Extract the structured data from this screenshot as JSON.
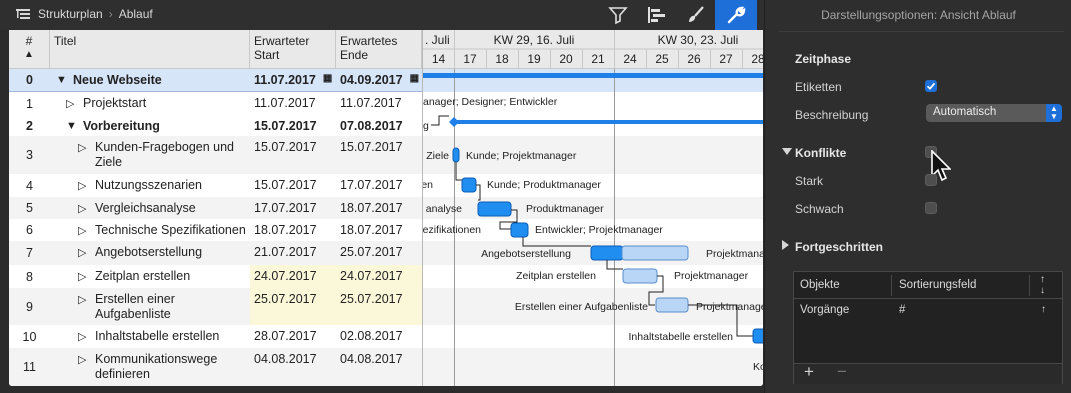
{
  "breadcrumb": {
    "item1": "Strukturplan",
    "item2": "Ablauf"
  },
  "toolbar": {
    "active_color": "#1f6fd8"
  },
  "table": {
    "headers": {
      "num": "#",
      "title": "Titel",
      "start_l1": "Erwarteter",
      "start_l2": "Start",
      "end_l1": "Erwartetes",
      "end_l2": "Ende"
    },
    "rows": [
      {
        "num": "0",
        "title": "Neue Webseite",
        "start": "11.07.2017",
        "end": "04.09.2017"
      },
      {
        "num": "1",
        "title": "Projektstart",
        "start": "11.07.2017",
        "end": "11.07.2017"
      },
      {
        "num": "2",
        "title": "Vorbereitung",
        "start": "15.07.2017",
        "end": "07.08.2017"
      },
      {
        "num": "3",
        "title": "Kunden-Fragebogen und",
        "title2": "Ziele",
        "start": "15.07.2017",
        "end": "15.07.2017"
      },
      {
        "num": "4",
        "title": "Nutzungsszenarien",
        "start": "15.07.2017",
        "end": "17.07.2017"
      },
      {
        "num": "5",
        "title": "Vergleichsanalyse",
        "start": "17.07.2017",
        "end": "18.07.2017"
      },
      {
        "num": "6",
        "title": "Technische Spezifikationen",
        "start": "18.07.2017",
        "end": "18.07.2017"
      },
      {
        "num": "7",
        "title": "Angebotserstellung",
        "start": "21.07.2017",
        "end": "25.07.2017"
      },
      {
        "num": "8",
        "title": "Zeitplan erstellen",
        "start": "24.07.2017",
        "end": "24.07.2017"
      },
      {
        "num": "9",
        "title": "Erstellen einer",
        "title2": "Aufgabenliste",
        "start": "25.07.2017",
        "end": "25.07.2017"
      },
      {
        "num": "10",
        "title": "Inhaltstabelle erstellen",
        "start": "28.07.2017",
        "end": "02.08.2017"
      },
      {
        "num": "11",
        "title": "Kommunikationswege",
        "title2": "definieren",
        "start": "04.08.2017",
        "end": "04.08.2017"
      }
    ]
  },
  "gantt": {
    "weeks": [
      ". Juli",
      "KW 29, 16. Juli",
      "KW 30, 23. Juli"
    ],
    "days": [
      "14",
      "17",
      "18",
      "19",
      "20",
      "21",
      "24",
      "25",
      "26",
      "27",
      "28"
    ],
    "labels": {
      "r1": "anager; Designer; Entwickler",
      "r2": "g",
      "r3a": "Ziele",
      "r3b": "Kunde; Projektmanager",
      "r4a": "ien",
      "r4b": "Kunde; Produktmanager",
      "r5a": "analyse",
      "r5b": "Produktmanager",
      "r6a": "ezifikationen",
      "r6b": "Entwickler; Projektmanager",
      "r7a": "Angebotserstellung",
      "r7b": "Projektmanager",
      "r8a": "Zeitplan erstellen",
      "r8b": "Projektmanager",
      "r9a": "Erstellen einer Aufgabenliste",
      "r9b": "Projektmanager",
      "r10a": "Inhaltstabelle erstellen",
      "r11a": "Kom"
    }
  },
  "inspector": {
    "title": "Darstellungsoptionen: Ansicht Ablauf",
    "zeitphase": "Zeitphase",
    "etiketten": "Etiketten",
    "beschreibung": "Beschreibung",
    "beschreibung_value": "Automatisch",
    "konflikte": "Konflikte",
    "stark": "Stark",
    "schwach": "Schwach",
    "fortgeschritten": "Fortgeschritten",
    "sort_table": {
      "col1": "Objekte",
      "col2": "Sortierungsfeld",
      "row_obj": "Vorgänge",
      "row_field": "#"
    },
    "add": "+",
    "remove": "−"
  }
}
